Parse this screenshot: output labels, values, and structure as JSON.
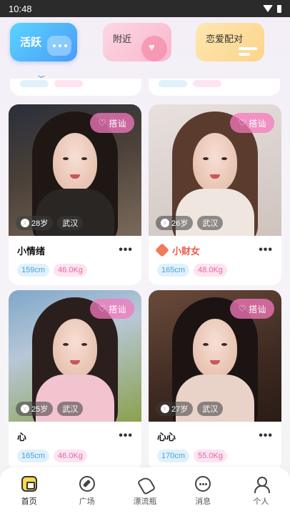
{
  "status_bar": {
    "time": "10:48"
  },
  "top_tabs": [
    {
      "label": "活跃",
      "active": true,
      "color": "#4a9bf8"
    },
    {
      "label": "附近",
      "active": false,
      "color": "#f9b7cc"
    },
    {
      "label": "恋爱配对",
      "active": false,
      "color": "#fbd48b"
    }
  ],
  "cards": [
    {
      "name": "小情绪",
      "vip": false,
      "age": "28岁",
      "city": "武汉",
      "height": "159cm",
      "weight": "46.0Kg",
      "flirt_label": "搭讪"
    },
    {
      "name": "小财女",
      "vip": true,
      "age": "26岁",
      "city": "武汉",
      "height": "165cm",
      "weight": "48.0Kg",
      "flirt_label": "搭讪"
    },
    {
      "name": "心",
      "vip": false,
      "age": "25岁",
      "city": "武汉",
      "height": "165cm",
      "weight": "46.0Kg",
      "flirt_label": "搭讪"
    },
    {
      "name": "心心",
      "vip": false,
      "age": "27岁",
      "city": "武汉",
      "height": "170cm",
      "weight": "55.0Kg",
      "flirt_label": "搭讪"
    }
  ],
  "bottom_nav": [
    {
      "label": "首页",
      "icon": "home-icon",
      "active": true
    },
    {
      "label": "广场",
      "icon": "compass-icon",
      "active": false
    },
    {
      "label": "漂流瓶",
      "icon": "bottle-icon",
      "active": false
    },
    {
      "label": "消息",
      "icon": "message-icon",
      "active": false
    },
    {
      "label": "个人",
      "icon": "user-icon",
      "active": false
    }
  ],
  "colors": {
    "accent": "#4a9bf8",
    "flirt": "#f578be",
    "vip_name": "#ee5a4a"
  }
}
